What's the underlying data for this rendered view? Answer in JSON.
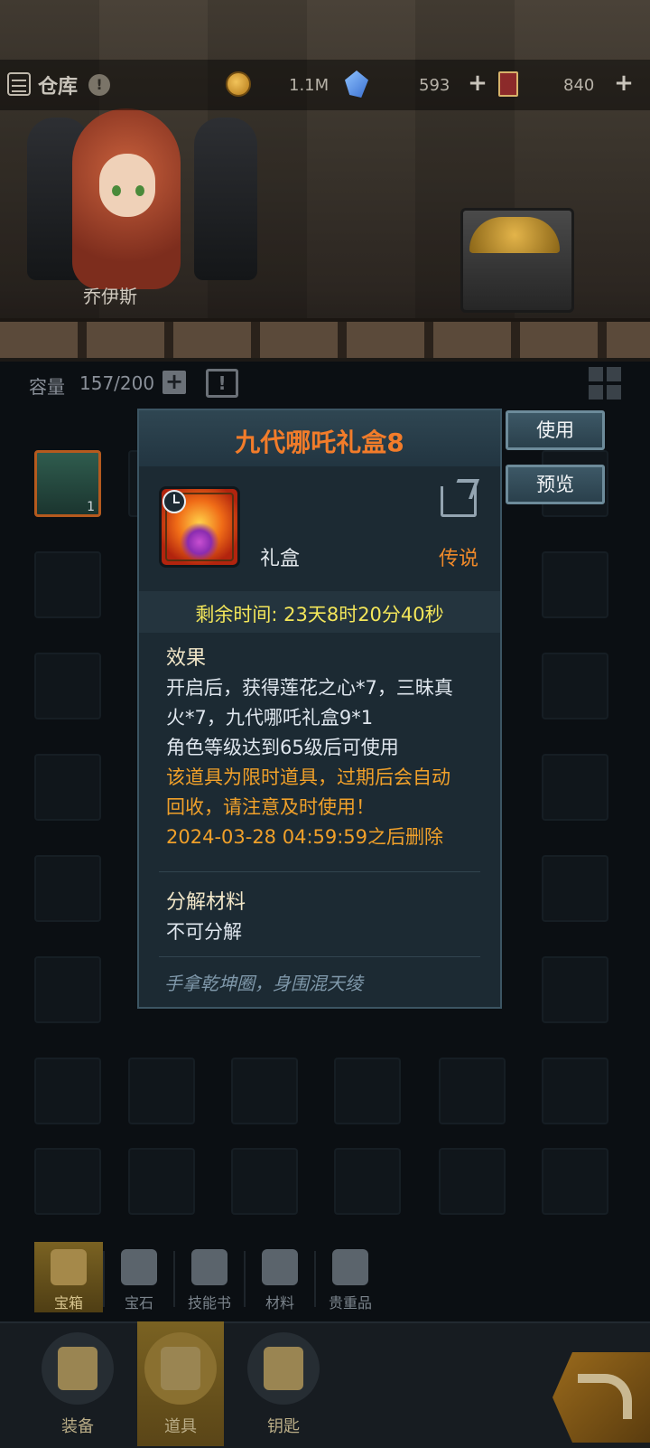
{
  "topbar": {
    "title": "仓库",
    "info": "!",
    "gold": "1.1M",
    "crystal": "593",
    "ticket": "840",
    "plus": "+"
  },
  "hero": {
    "name": "乔伊斯"
  },
  "inventory": {
    "capacity_label": "容量",
    "capacity_value": "157/200",
    "plus": "+",
    "sort": "!",
    "first_item_count": "1"
  },
  "popup": {
    "title": "九代哪吒礼盒8",
    "type": "礼盒",
    "rarity": "传说",
    "time_remaining": "剩余时间: 23天8时20分40秒",
    "effect_title": "效果",
    "effect_lines": [
      "开启后，获得莲花之心*7，三昧真",
      "火*7，九代哪吒礼盒9*1",
      "角色等级达到65级后可使用"
    ],
    "warning_lines": [
      "该道具为限时道具，过期后会自动",
      "回收，请注意及时使用！",
      "2024-03-28 04:59:59之后删除"
    ],
    "decompose_title": "分解材料",
    "decompose_value": "不可分解",
    "flavor": "手拿乾坤圈，身围混天绫"
  },
  "actions": {
    "use": "使用",
    "preview": "预览"
  },
  "categories": [
    {
      "label": "宝箱",
      "icon": "chest-icon",
      "active": true
    },
    {
      "label": "宝石",
      "icon": "gem-icon",
      "active": false
    },
    {
      "label": "技能书",
      "icon": "book-icon",
      "active": false
    },
    {
      "label": "材料",
      "icon": "material-icon",
      "active": false
    },
    {
      "label": "贵重品",
      "icon": "valuables-icon",
      "active": false
    }
  ],
  "nav": [
    {
      "label": "装备",
      "icon": "equipment-icon",
      "active": false
    },
    {
      "label": "道具",
      "icon": "item-bag-icon",
      "active": true
    },
    {
      "label": "钥匙",
      "icon": "key-icon",
      "active": false
    }
  ],
  "colors": {
    "title_orange": "#f27c2a",
    "rarity_orange": "#f08a2a",
    "time_yellow": "#f3e65a",
    "warning_orange": "#f0a02a",
    "popup_bg": "#1c2a33"
  }
}
